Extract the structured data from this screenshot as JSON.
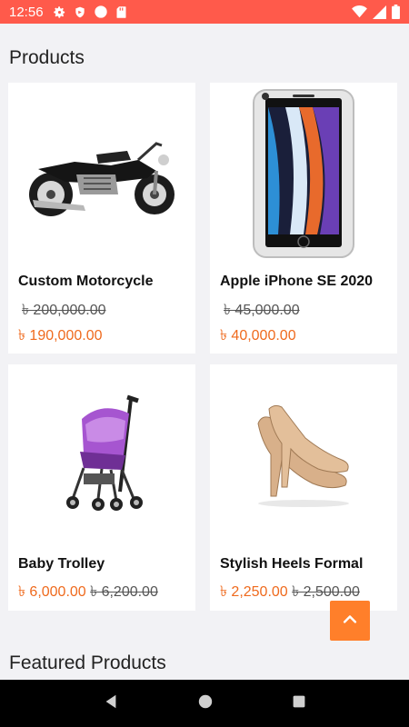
{
  "status_bar": {
    "time": "12:56",
    "icons_left": [
      "gear-icon",
      "shield-icon",
      "circle-icon",
      "sd-card-icon"
    ],
    "icons_right": [
      "wifi-icon",
      "signal-icon",
      "battery-icon"
    ],
    "background": "#ff5a4b"
  },
  "sections": {
    "products_title": "Products",
    "featured_title": "Featured Products"
  },
  "products": [
    {
      "name": "Custom Motorcycle",
      "old_price": "৳ 200,000.00",
      "new_price": "৳ 190,000.00",
      "image": "motorcycle"
    },
    {
      "name": "Apple iPhone SE 2020",
      "old_price": "৳ 45,000.00",
      "new_price": "৳ 40,000.00",
      "image": "phone"
    },
    {
      "name": "Baby Trolley",
      "old_price": "৳ 6,200.00",
      "new_price": "৳ 6,000.00",
      "image": "stroller"
    },
    {
      "name": "Stylish Heels Formal",
      "old_price": "৳ 2,500.00",
      "new_price": "৳ 2,250.00",
      "image": "heels"
    }
  ],
  "scroll_top_button": {
    "icon": "chevron-up-icon",
    "color": "#ff7f2a"
  },
  "nav_bar": {
    "icons": [
      "back-icon",
      "home-icon",
      "recents-icon"
    ]
  },
  "colors": {
    "accent": "#ef6a1d",
    "background": "#f2f2f5"
  }
}
